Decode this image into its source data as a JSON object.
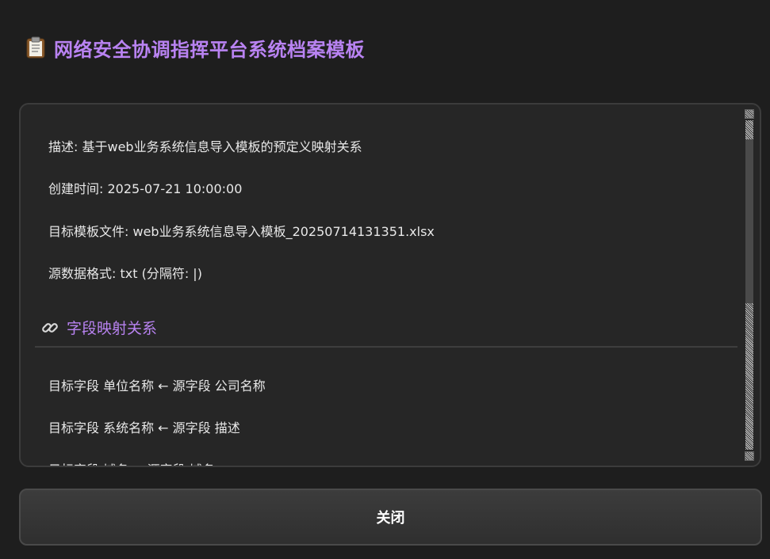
{
  "header": {
    "title": "网络安全协调指挥平台系统档案模板",
    "icon": "clipboard-icon"
  },
  "details": {
    "description": "描述: 基于web业务系统信息导入模板的预定义映射关系",
    "created_time": "创建时间: 2025-07-21 10:00:00",
    "target_file": "目标模板文件: web业务系统信息导入模板_20250714131351.xlsx",
    "source_format": "源数据格式: txt (分隔符: |)"
  },
  "mapping_section": {
    "icon": "link-icon",
    "title": "字段映射关系",
    "rows": [
      "目标字段 单位名称 ← 源字段 公司名称",
      "目标字段 系统名称 ← 源字段 描述",
      "目标字段 域名 ← 源字段 域名"
    ]
  },
  "footer": {
    "close_label": "关闭"
  },
  "colors": {
    "accent": "#b983f2",
    "background": "#1e1e1e",
    "panel": "#262626"
  }
}
